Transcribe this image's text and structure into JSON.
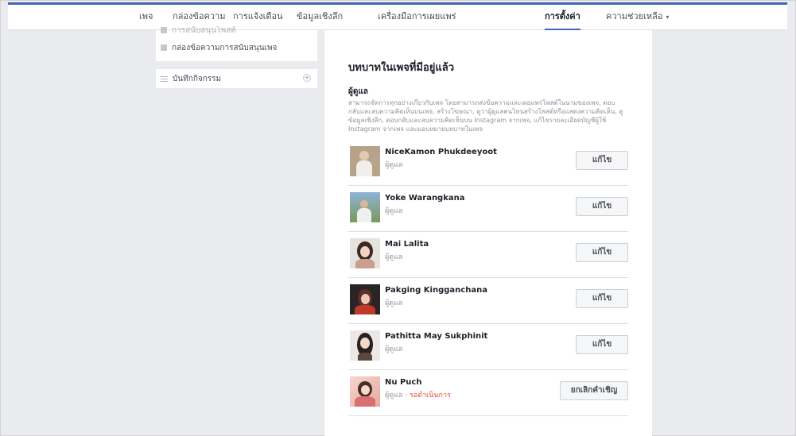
{
  "nav": {
    "items": [
      {
        "label": "เพจ"
      },
      {
        "label": "กล่องข้อความ"
      },
      {
        "label": "การแจ้งเตือน"
      },
      {
        "label": "ข้อมูลเชิงลึก"
      },
      {
        "label": "เครื่องมือการเผยแพร่"
      },
      {
        "label": "การตั้งค่า"
      },
      {
        "label": "ความช่วยเหลือ"
      }
    ],
    "active": "การตั้งค่า"
  },
  "sidebar": {
    "cut_item": "การสนับสนุนโพสต์",
    "support_inbox": "กล่องข้อความการสนับสนุนเพจ",
    "activity_log": "บันทึกกิจกรรม"
  },
  "main": {
    "title": "บทบาทในเพจที่มีอยู่แล้ว",
    "section_title": "ผู้ดูแล",
    "section_desc": "สามารถจัดการทุกอย่างเกี่ยวกับเพจ โดยสามารถส่งข้อความและเผยแพร่โพสต์ในนามของเพจ, ตอบกลับและลบความคิดเห็นบนเพจ, สร้างโฆษณา, ดูว่าผู้ดูแลคนไหนสร้างโพสต์หรือแสดงความคิดเห็น, ดูข้อมูลเชิงลึก, ตอบกลับและลบความคิดเห็นบน Instagram จากเพจ, แก้ไขรายละเอียดบัญชีผู้ใช้ Instagram จากเพจ และมอบหมายบทบาทในเพจ",
    "admins": [
      {
        "name": "NiceKamon Phukdeeyoot",
        "role": "ผู้ดูแล",
        "button": "แก้ไข"
      },
      {
        "name": "Yoke Warangkana",
        "role": "ผู้ดูแล",
        "button": "แก้ไข"
      },
      {
        "name": "Mai Lalita",
        "role": "ผู้ดูแล",
        "button": "แก้ไข"
      },
      {
        "name": "Pakging Kingganchana",
        "role": "ผู้ดูแล",
        "button": "แก้ไข"
      },
      {
        "name": "Pathitta May Sukphinit",
        "role": "ผู้ดูแล",
        "button": "แก้ไข"
      },
      {
        "name": "Nu Puch",
        "role": "ผู้ดูแล",
        "pending": "รอดำเนินการ",
        "button": "ยกเลิกคำเชิญ"
      }
    ]
  },
  "colors": {
    "accent": "#4267b2",
    "background": "#e9ebee",
    "pending": "#e74c3c"
  }
}
